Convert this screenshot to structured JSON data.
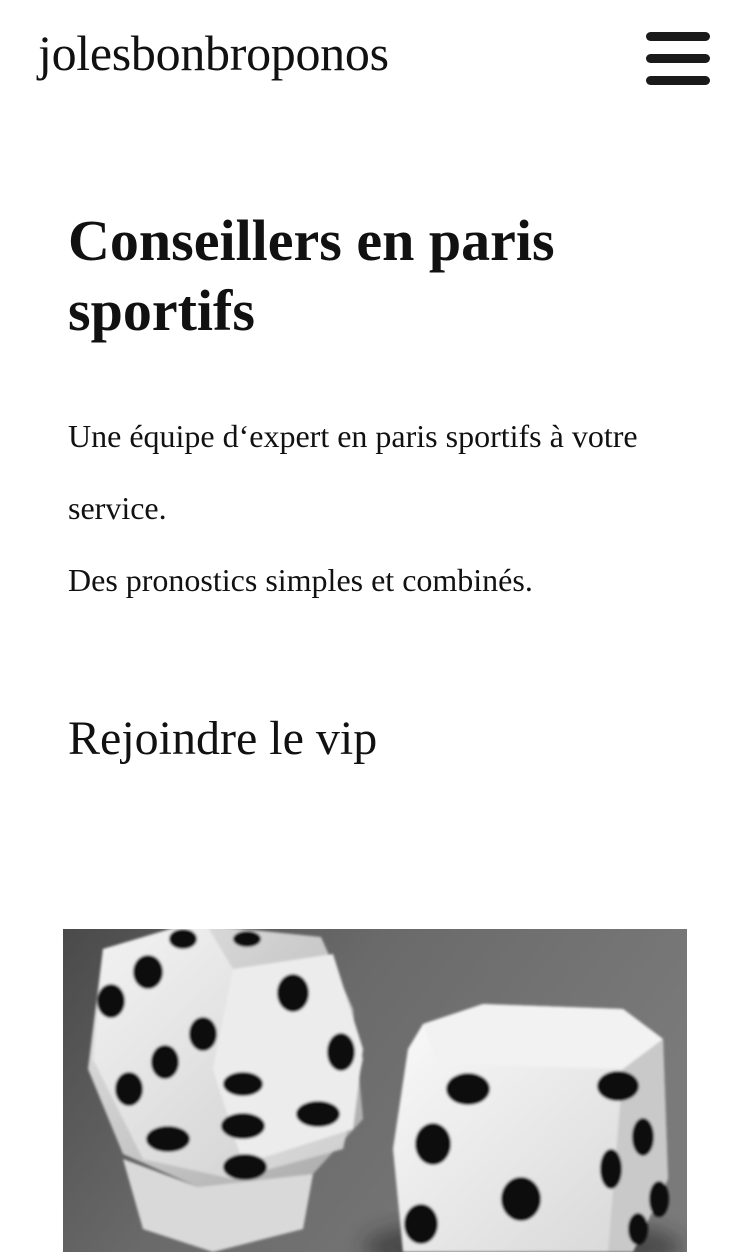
{
  "header": {
    "site_title": "jolesbonbroponos",
    "menu_icon": "hamburger-menu-icon"
  },
  "hero": {
    "title": "Conseillers en paris sportifs",
    "intro_line1": "Une équipe d‘expert en paris sportifs à votre service.",
    "intro_line2": "Des pronostics simples et combinés.",
    "cta_label": "Rejoindre le vip"
  },
  "image": {
    "subject": "dice-photo"
  }
}
